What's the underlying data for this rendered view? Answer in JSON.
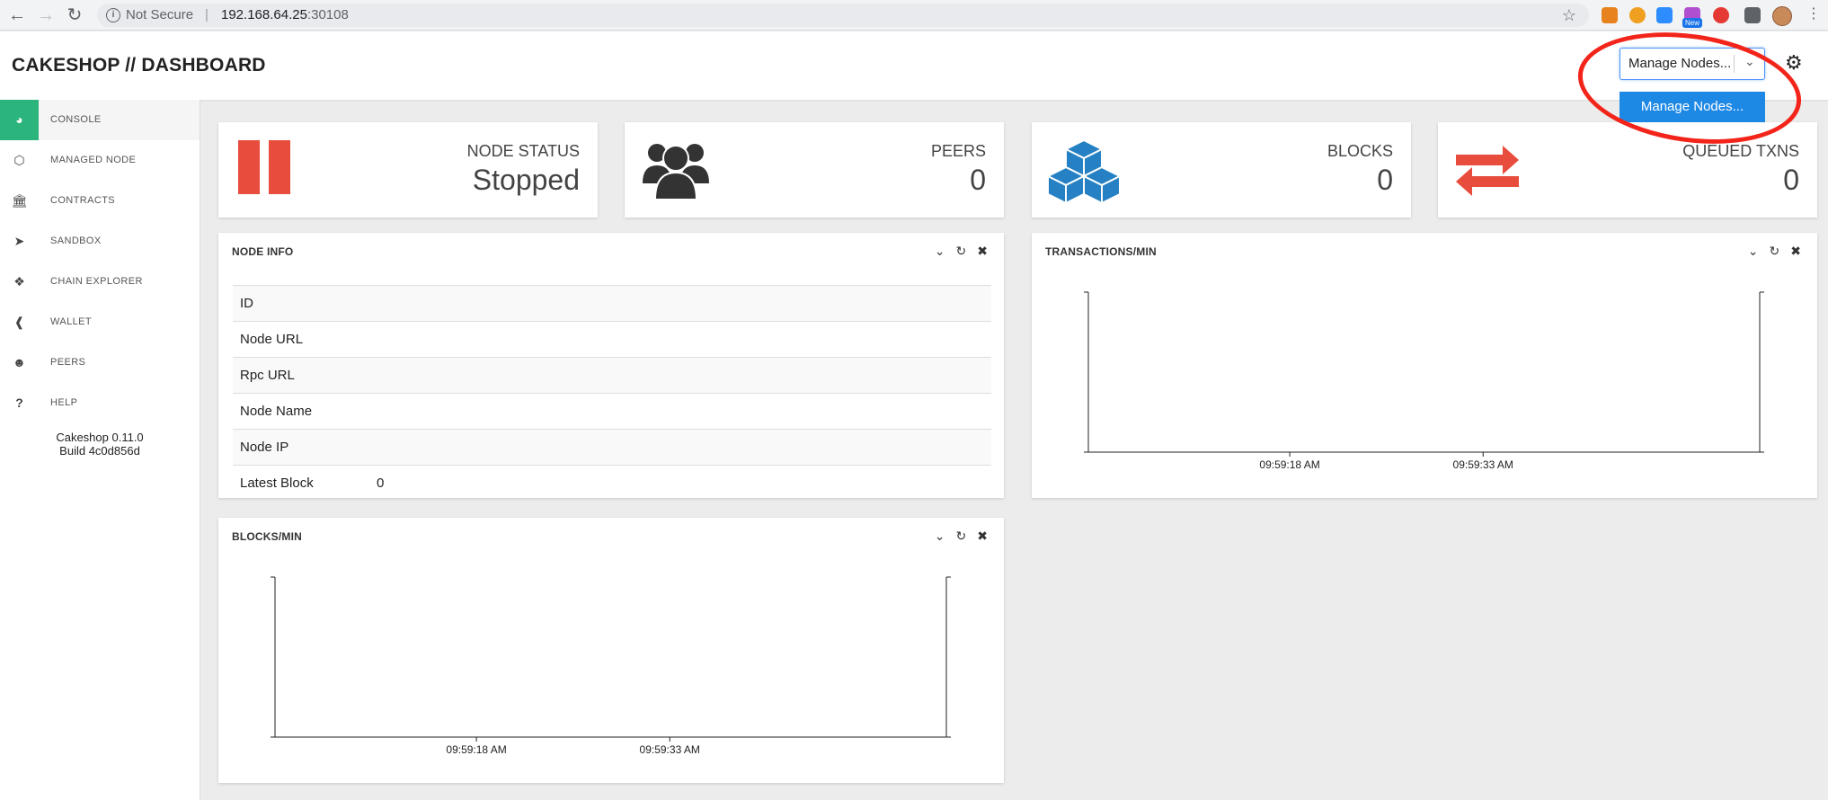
{
  "browser": {
    "security_label": "Not Secure",
    "url_host": "192.168.64.25",
    "url_port": ":30108",
    "ext_new_badge": "New"
  },
  "header": {
    "title": "CAKESHOP // DASHBOARD",
    "node_select_value": "Manage Nodes...",
    "dropdown_option": "Manage Nodes..."
  },
  "sidebar": {
    "items": [
      {
        "label": "CONSOLE",
        "icon": "dashboard-icon"
      },
      {
        "label": "MANAGED NODE",
        "icon": "codepen-icon"
      },
      {
        "label": "CONTRACTS",
        "icon": "bank-icon"
      },
      {
        "label": "SANDBOX",
        "icon": "paper-plane-icon"
      },
      {
        "label": "CHAIN EXPLORER",
        "icon": "cubes-icon"
      },
      {
        "label": "WALLET",
        "icon": "wallet-icon"
      },
      {
        "label": "PEERS",
        "icon": "users-icon"
      },
      {
        "label": "HELP",
        "icon": "question-icon"
      }
    ],
    "version": "Cakeshop 0.11.0",
    "build": "Build 4c0d856d"
  },
  "stats": {
    "node_status": {
      "title": "NODE STATUS",
      "value": "Stopped"
    },
    "peers": {
      "title": "PEERS",
      "value": "0"
    },
    "blocks": {
      "title": "BLOCKS",
      "value": "0"
    },
    "queued": {
      "title": "QUEUED TXNS",
      "value": "0"
    }
  },
  "node_info": {
    "title": "NODE INFO",
    "rows": [
      {
        "key": "ID",
        "value": ""
      },
      {
        "key": "Node URL",
        "value": ""
      },
      {
        "key": "Rpc URL",
        "value": ""
      },
      {
        "key": "Node Name",
        "value": ""
      },
      {
        "key": "Node IP",
        "value": ""
      },
      {
        "key": "Latest Block",
        "value": "0"
      }
    ]
  },
  "panels": {
    "transactions_title": "TRANSACTIONS/MIN",
    "blocks_title": "BLOCKS/MIN"
  },
  "colors": {
    "accent_green": "#2bb57d",
    "stat_red": "#e74c3c",
    "stat_blue": "#2581c4",
    "select_blue": "#1e88e5",
    "annotation_red": "#f3241a"
  },
  "chart_data": [
    {
      "type": "line",
      "title": "TRANSACTIONS/MIN",
      "x": [
        "09:59:18 AM",
        "09:59:33 AM"
      ],
      "series": [],
      "xlabel": "",
      "ylabel": ""
    },
    {
      "type": "line",
      "title": "BLOCKS/MIN",
      "x": [
        "09:59:18 AM",
        "09:59:33 AM"
      ],
      "series": [],
      "xlabel": "",
      "ylabel": ""
    }
  ]
}
